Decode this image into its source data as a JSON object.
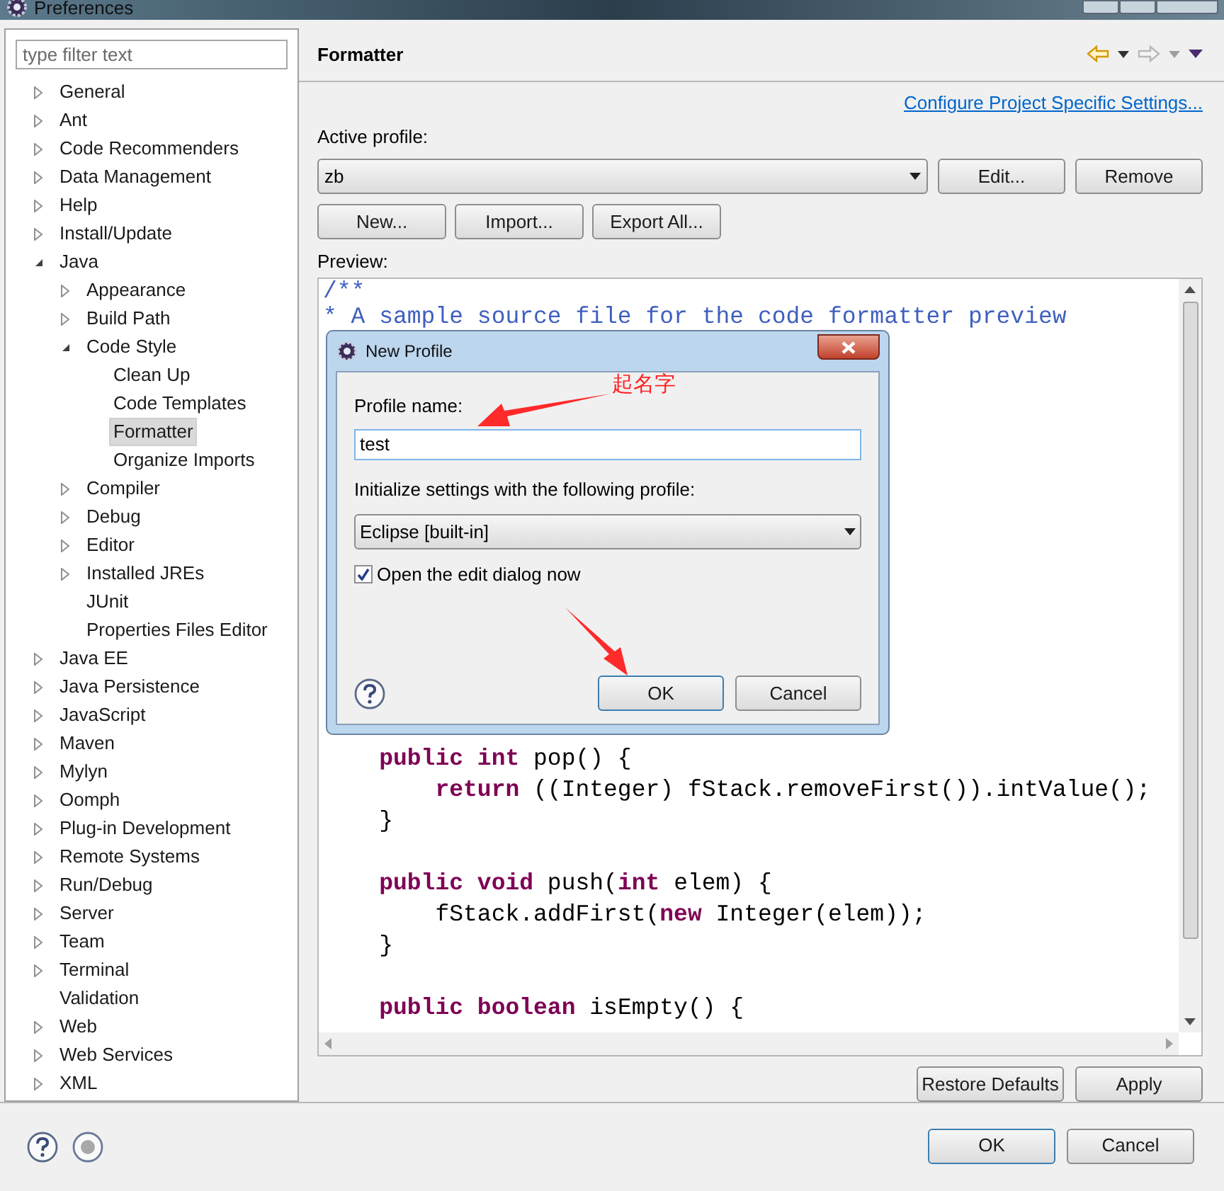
{
  "window": {
    "title": "Preferences"
  },
  "filter": {
    "placeholder": "type filter text"
  },
  "tree": [
    {
      "label": "General",
      "expanded": false,
      "selected": false
    },
    {
      "label": "Ant",
      "expanded": false,
      "selected": false
    },
    {
      "label": "Code Recommenders",
      "expanded": false,
      "selected": false
    },
    {
      "label": "Data Management",
      "expanded": false,
      "selected": false
    },
    {
      "label": "Help",
      "expanded": false,
      "selected": false
    },
    {
      "label": "Install/Update",
      "expanded": false,
      "selected": false
    },
    {
      "label": "Java",
      "expanded": true,
      "selected": false,
      "children": [
        {
          "label": "Appearance",
          "expanded": false,
          "selected": false
        },
        {
          "label": "Build Path",
          "expanded": false,
          "selected": false
        },
        {
          "label": "Code Style",
          "expanded": true,
          "selected": false,
          "children": [
            {
              "label": "Clean Up",
              "selected": false
            },
            {
              "label": "Code Templates",
              "selected": false
            },
            {
              "label": "Formatter",
              "selected": true
            },
            {
              "label": "Organize Imports",
              "selected": false
            }
          ]
        },
        {
          "label": "Compiler",
          "expanded": false,
          "selected": false
        },
        {
          "label": "Debug",
          "expanded": false,
          "selected": false
        },
        {
          "label": "Editor",
          "expanded": false,
          "selected": false
        },
        {
          "label": "Installed JREs",
          "expanded": false,
          "selected": false
        },
        {
          "label": "JUnit",
          "selected": false
        },
        {
          "label": "Properties Files Editor",
          "selected": false
        }
      ]
    },
    {
      "label": "Java EE",
      "expanded": false,
      "selected": false
    },
    {
      "label": "Java Persistence",
      "expanded": false,
      "selected": false
    },
    {
      "label": "JavaScript",
      "expanded": false,
      "selected": false
    },
    {
      "label": "Maven",
      "expanded": false,
      "selected": false
    },
    {
      "label": "Mylyn",
      "expanded": false,
      "selected": false
    },
    {
      "label": "Oomph",
      "expanded": false,
      "selected": false
    },
    {
      "label": "Plug-in Development",
      "expanded": false,
      "selected": false
    },
    {
      "label": "Remote Systems",
      "expanded": false,
      "selected": false
    },
    {
      "label": "Run/Debug",
      "expanded": false,
      "selected": false
    },
    {
      "label": "Server",
      "expanded": false,
      "selected": false
    },
    {
      "label": "Team",
      "expanded": false,
      "selected": false
    },
    {
      "label": "Terminal",
      "expanded": false,
      "selected": false
    },
    {
      "label": "Validation",
      "selected": false
    },
    {
      "label": "Web",
      "expanded": false,
      "selected": false
    },
    {
      "label": "Web Services",
      "expanded": false,
      "selected": false
    },
    {
      "label": "XML",
      "expanded": false,
      "selected": false
    }
  ],
  "page": {
    "title": "Formatter",
    "link": "Configure Project Specific Settings...",
    "active_profile_label": "Active profile:",
    "active_profile": "zb",
    "profile_buttons": [
      "Edit...",
      "Remove"
    ],
    "buttons": [
      "New...",
      "Import...",
      "Export All..."
    ],
    "preview_label": "Preview:",
    "preview_top": [
      [
        {
          "kind": "comment",
          "text": "/**"
        }
      ],
      [
        {
          "kind": "comment",
          "text": "* A sample source file for the code formatter preview"
        }
      ]
    ],
    "preview_blocks": [
      [
        [
          {
            "kind": "keyword",
            "text": "    public int"
          },
          {
            "kind": "plain",
            "text": " pop() {"
          }
        ],
        [
          {
            "kind": "keyword",
            "text": "        return"
          },
          {
            "kind": "plain",
            "text": " ((Integer) fStack.removeFirst()).intValue();"
          }
        ],
        [
          {
            "kind": "plain",
            "text": "    }"
          }
        ]
      ],
      [
        [
          {
            "kind": "keyword",
            "text": "    public void"
          },
          {
            "kind": "plain",
            "text": " push("
          },
          {
            "kind": "keyword",
            "text": "int"
          },
          {
            "kind": "plain",
            "text": " elem) {"
          }
        ],
        [
          {
            "kind": "plain",
            "text": "        fStack.addFirst("
          },
          {
            "kind": "keyword",
            "text": "new"
          },
          {
            "kind": "plain",
            "text": " Integer(elem));"
          }
        ],
        [
          {
            "kind": "plain",
            "text": "    }"
          }
        ]
      ],
      [
        [
          {
            "kind": "keyword",
            "text": "    public boolean"
          },
          {
            "kind": "plain",
            "text": " isEmpty() {"
          }
        ]
      ]
    ],
    "page_buttons": [
      "Restore Defaults",
      "Apply"
    ]
  },
  "footer_buttons": [
    {
      "label": "OK",
      "default": true
    },
    {
      "label": "Cancel",
      "default": false
    }
  ],
  "dialog": {
    "title": "New Profile",
    "name_label": "Profile name:",
    "name_value": "test",
    "init_label": "Initialize settings with the following profile:",
    "init_profile": "Eclipse [built-in]",
    "open_edit": {
      "label": "Open the edit dialog now",
      "checked": true
    },
    "buttons": [
      {
        "label": "OK",
        "default": true
      },
      {
        "label": "Cancel",
        "default": false
      }
    ]
  },
  "annotation": {
    "text": "起名字"
  }
}
